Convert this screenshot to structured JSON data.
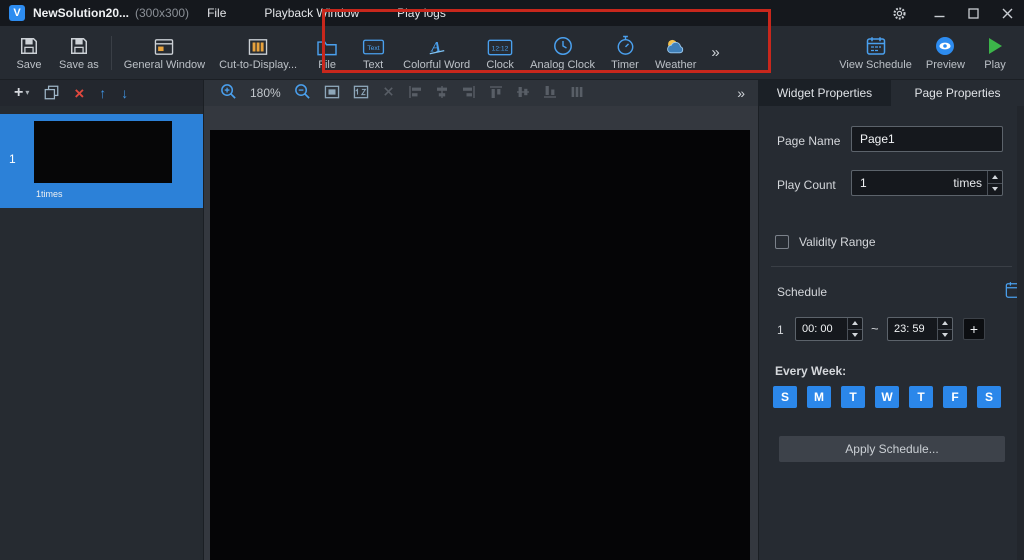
{
  "window": {
    "logo_text": "V",
    "title": "NewSolution20...",
    "size_label": "(300x300)",
    "menus": [
      {
        "label": "File"
      },
      {
        "label": "Playback Window"
      },
      {
        "label": "Play logs"
      }
    ]
  },
  "toolbar": {
    "save": "Save",
    "save_as": "Save as",
    "general_window": "General Window",
    "cut_to_display": "Cut-to-Display...",
    "widgets": [
      {
        "label": "File",
        "icon": "folder-icon"
      },
      {
        "label": "Text",
        "icon": "text-icon",
        "icon_text": "Text"
      },
      {
        "label": "Colorful Word",
        "icon": "colorful-word-icon",
        "icon_text": "A"
      },
      {
        "label": "Clock",
        "icon": "digital-clock-icon",
        "icon_text": "12:12"
      },
      {
        "label": "Analog Clock",
        "icon": "analog-clock-icon"
      },
      {
        "label": "Timer",
        "icon": "timer-icon"
      },
      {
        "label": "Weather",
        "icon": "weather-icon"
      }
    ],
    "more": "»",
    "view_schedule": "View Schedule",
    "preview": "Preview",
    "play": "Play"
  },
  "pagebar": {
    "add": "+",
    "caret": "▾",
    "delete": "×",
    "move_up": "↑",
    "move_down": "↓"
  },
  "canvasbar": {
    "zoom_level": "180%",
    "more": "»"
  },
  "tabs": {
    "widget_properties": "Widget Properties",
    "page_properties": "Page Properties"
  },
  "pages_panel": {
    "items": [
      {
        "index": "1",
        "repeat_label": "1times"
      }
    ]
  },
  "properties": {
    "page_name_label": "Page Name",
    "page_name_value": "Page1",
    "play_count_label": "Play Count",
    "play_count_value": "1",
    "play_count_unit": "times",
    "validity_range_label": "Validity Range",
    "schedule_label": "Schedule",
    "schedule_rows": [
      {
        "index": "1",
        "start": "00: 00",
        "end": "23: 59"
      }
    ],
    "range_separator": "~",
    "add_row": "+",
    "every_week_label": "Every Week:",
    "week_days": [
      "S",
      "M",
      "T",
      "W",
      "T",
      "F",
      "S"
    ],
    "apply_button": "Apply Schedule..."
  },
  "colors": {
    "accent_blue": "#2d8cf0",
    "play_green": "#3cb54a",
    "delete_red": "#e0483e",
    "annotation_red": "#c8271c"
  }
}
